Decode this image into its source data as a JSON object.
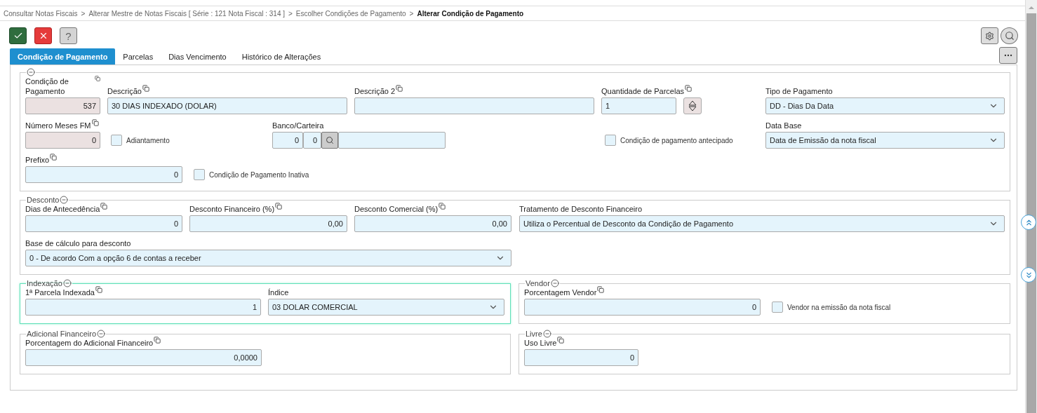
{
  "breadcrumb": {
    "separator": ">",
    "items": [
      {
        "label": "Consultar Notas Fiscais",
        "current": false
      },
      {
        "label": "Alterar Mestre de Notas Fiscais [ Série : 121 Nota Fiscal : 314 ]",
        "current": false
      },
      {
        "label": "Escolher Condições de Pagamento",
        "current": false
      },
      {
        "label": "Alterar Condição de Pagamento",
        "current": true
      }
    ]
  },
  "toolbar": {
    "buttons": [
      {
        "kind": "confirm"
      },
      {
        "kind": "cancel"
      },
      {
        "kind": "help",
        "label": "?"
      }
    ],
    "tools": [
      {
        "kind": "settings"
      },
      {
        "kind": "search"
      }
    ]
  },
  "tabs": [
    {
      "label": "Condição de Pagamento",
      "selected": true
    },
    {
      "label": "Parcelas",
      "selected": false
    },
    {
      "label": "Dias Vencimento",
      "selected": false
    },
    {
      "label": "Histórico de Alterações",
      "selected": false
    }
  ],
  "sections": [
    {
      "focused": false,
      "rows": [
        [
          {
            "kind": "number",
            "label": "Condição de Pagamento",
            "value": "537",
            "readonly": true,
            "copyable": true
          },
          {
            "kind": "text",
            "label": "Descrição",
            "value": "30 DIAS INDEXADO (DOLAR)",
            "readonly": false,
            "copyable": true
          },
          {
            "kind": "text",
            "label": "Descrição 2",
            "readonly": false,
            "copyable": true
          },
          {
            "kind": "stepper",
            "label": "Quantidade de Parcelas",
            "value": "1",
            "readonly": false,
            "copyable": true
          },
          {
            "kind": "select",
            "label": "Tipo de Pagamento",
            "value": "DD - Dias Da Data"
          }
        ],
        [
          {
            "kind": "number",
            "label": "Número Meses FM",
            "value": "0",
            "readonly": true,
            "copyable": true
          },
          {
            "kind": "checkbox",
            "label": "Adiantamento",
            "checked": false
          },
          {
            "kind": "lookup",
            "label": "Banco/Carteira",
            "values": [
              "0",
              "0"
            ]
          },
          {
            "kind": "checkbox",
            "label": "Condição de pagamento antecipado",
            "checked": false
          },
          {
            "kind": "select",
            "label": "Data Base",
            "value": "Data de Emissão da nota fiscal"
          }
        ],
        [
          {
            "kind": "number",
            "label": "Prefixo",
            "value": "0",
            "readonly": false,
            "copyable": true
          },
          {
            "kind": "checkbox",
            "label": "Condição de Pagamento Inativa",
            "checked": false
          }
        ]
      ]
    },
    {
      "title": "Desconto",
      "focused": false,
      "rows": [
        [
          {
            "kind": "number",
            "label": "Dias de Antecedência",
            "value": "0",
            "readonly": false,
            "copyable": true
          },
          {
            "kind": "number",
            "label": "Desconto Financeiro (%)",
            "value": "0,00",
            "readonly": false,
            "copyable": true
          },
          {
            "kind": "number",
            "label": "Desconto Comercial (%)",
            "value": "0,00",
            "readonly": false,
            "copyable": true
          },
          {
            "kind": "select",
            "label": "Tratamento de Desconto Financeiro",
            "value": "Utiliza o Percentual de Desconto da Condição de Pagamento"
          }
        ],
        [
          {
            "kind": "select",
            "label": "Base de cálculo para desconto",
            "value": "0 - De acordo Com a opção 6 de contas a receber"
          }
        ]
      ]
    },
    {
      "title": "Indexação",
      "focused": true,
      "rows": [
        [
          {
            "kind": "number",
            "label": "1ª Parcela Indexada",
            "value": "1",
            "readonly": false,
            "copyable": true
          },
          {
            "kind": "select",
            "label": "Índice",
            "value": "03 DOLAR COMERCIAL"
          }
        ]
      ]
    },
    {
      "title": "Vendor",
      "focused": false,
      "rows": [
        [
          {
            "kind": "number",
            "label": "Porcentagem Vendor",
            "value": "0",
            "readonly": false,
            "copyable": true
          },
          {
            "kind": "checkbox",
            "label": "Vendor na emissão da nota fiscal",
            "checked": false
          }
        ]
      ]
    },
    {
      "title": "Adicional Financeiro",
      "focused": false,
      "rows": [
        [
          {
            "kind": "number",
            "label": "Porcentagem do Adicional Financeiro",
            "value": "0,0000",
            "readonly": false,
            "copyable": true
          }
        ]
      ]
    },
    {
      "title": "Livre",
      "focused": false,
      "rows": [
        [
          {
            "kind": "number",
            "label": "Uso Livre",
            "value": "0",
            "readonly": false,
            "copyable": true
          }
        ]
      ]
    }
  ]
}
